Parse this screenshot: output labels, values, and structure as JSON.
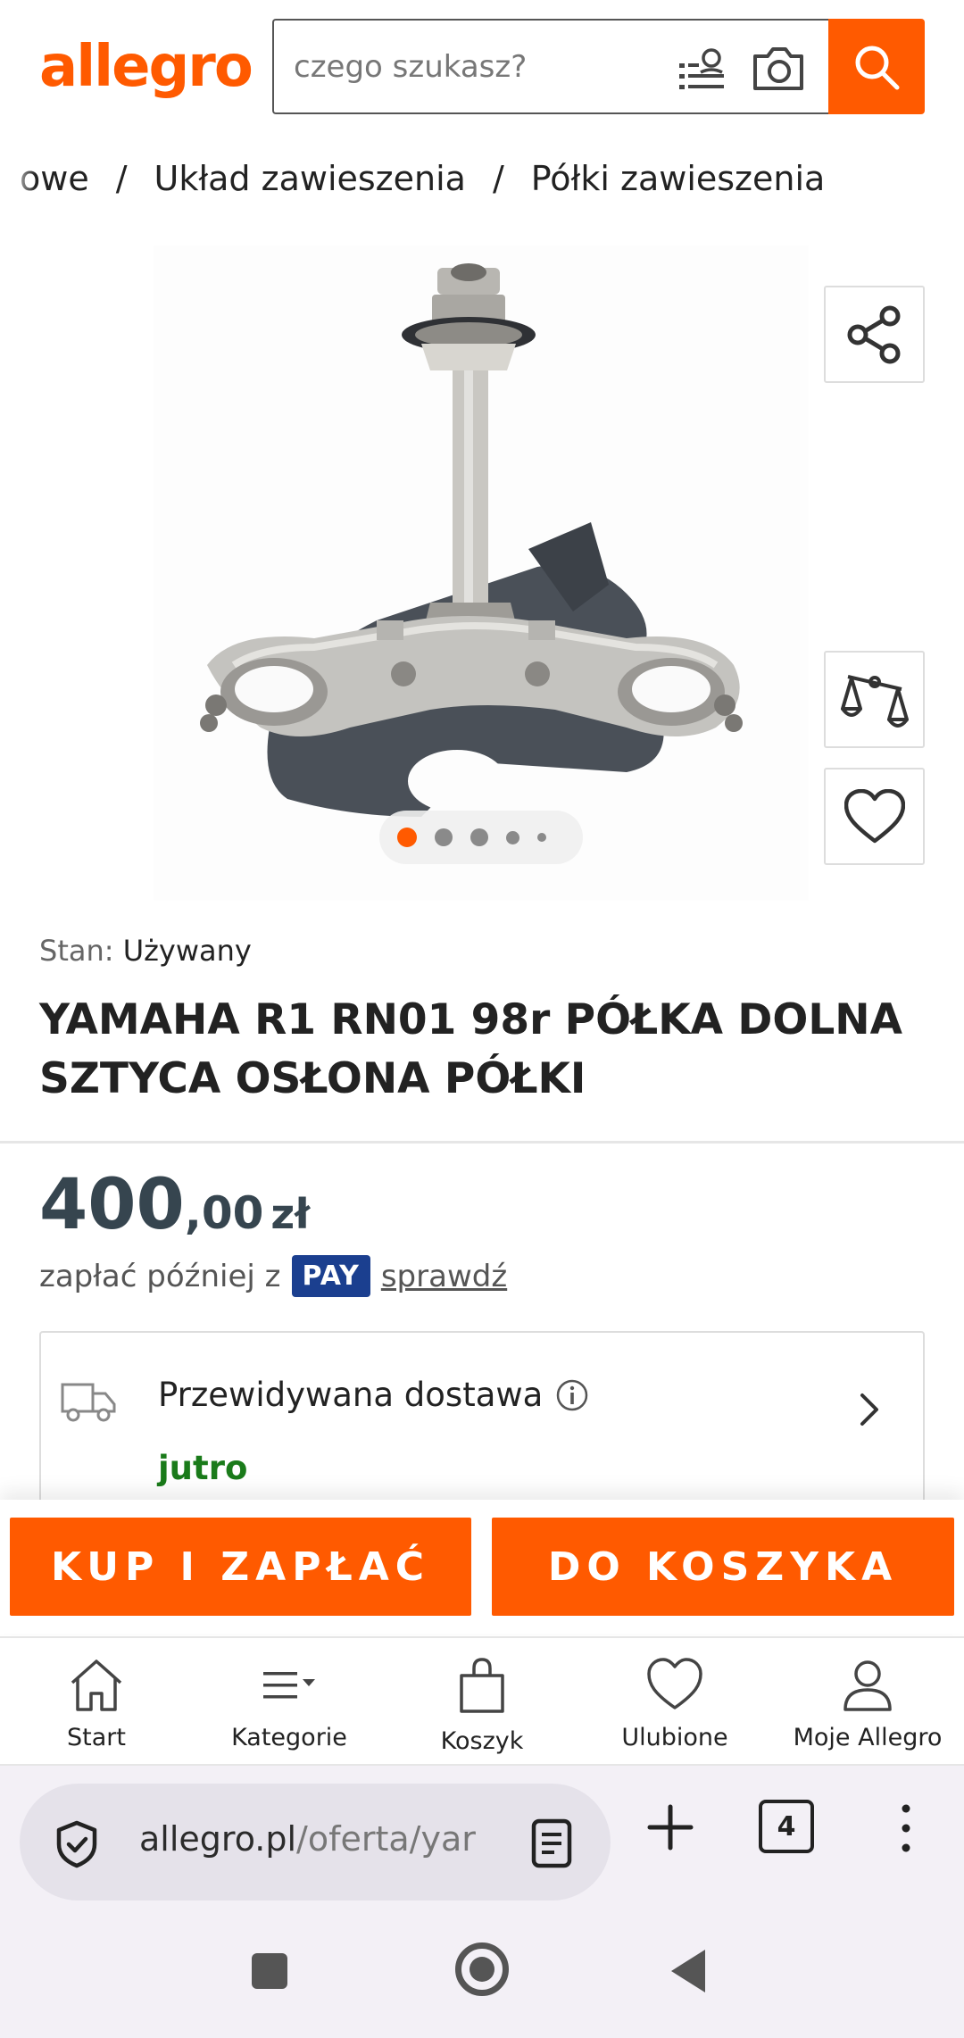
{
  "brand": {
    "logo_text": "allegro",
    "accent_color": "#ff5a00"
  },
  "search": {
    "placeholder": "czego szukasz?",
    "filter_icon": "filter-list-icon",
    "camera_icon": "camera-icon",
    "button_icon": "search-icon"
  },
  "breadcrumb": {
    "items": [
      "owe",
      "Układ zawieszenia",
      "Półki zawieszenia"
    ],
    "separator": "/"
  },
  "gallery": {
    "image_count": 5,
    "active_index": 0,
    "image_alt": "Yamaha R1 lower triple clamp with steering stem and cover"
  },
  "side_actions": {
    "share_icon": "share-icon",
    "compare_icon": "scales-compare-icon",
    "favorite_icon": "heart-icon"
  },
  "product": {
    "condition_label": "Stan:",
    "condition_value": "Używany",
    "title": "YAMAHA R1 RN01 98r PÓŁKA DOLNA SZTYCA OSŁONA PÓŁKI"
  },
  "price": {
    "integer": "400",
    "decimal": ",00",
    "currency": "zł"
  },
  "pay_later": {
    "prefix": "zapłać później z",
    "badge": "PAY",
    "link": "sprawdź"
  },
  "delivery": {
    "label": "Przewidywana dostawa",
    "when": "jutro",
    "when_color": "#1a7b1a"
  },
  "cta": {
    "buy_now": "KUP I ZAPŁAĆ",
    "add_to_cart": "DO KOSZYKA"
  },
  "bottom_nav": {
    "items": [
      {
        "label": "Start",
        "icon": "home-icon"
      },
      {
        "label": "Kategorie",
        "icon": "categories-icon"
      },
      {
        "label": "Koszyk",
        "icon": "cart-bag-icon"
      },
      {
        "label": "Ulubione",
        "icon": "heart-icon"
      },
      {
        "label": "Moje Allegro",
        "icon": "user-icon"
      }
    ]
  },
  "browser": {
    "url_host": "allegro.pl",
    "url_path": "/oferta/yar",
    "tab_count": "4"
  }
}
